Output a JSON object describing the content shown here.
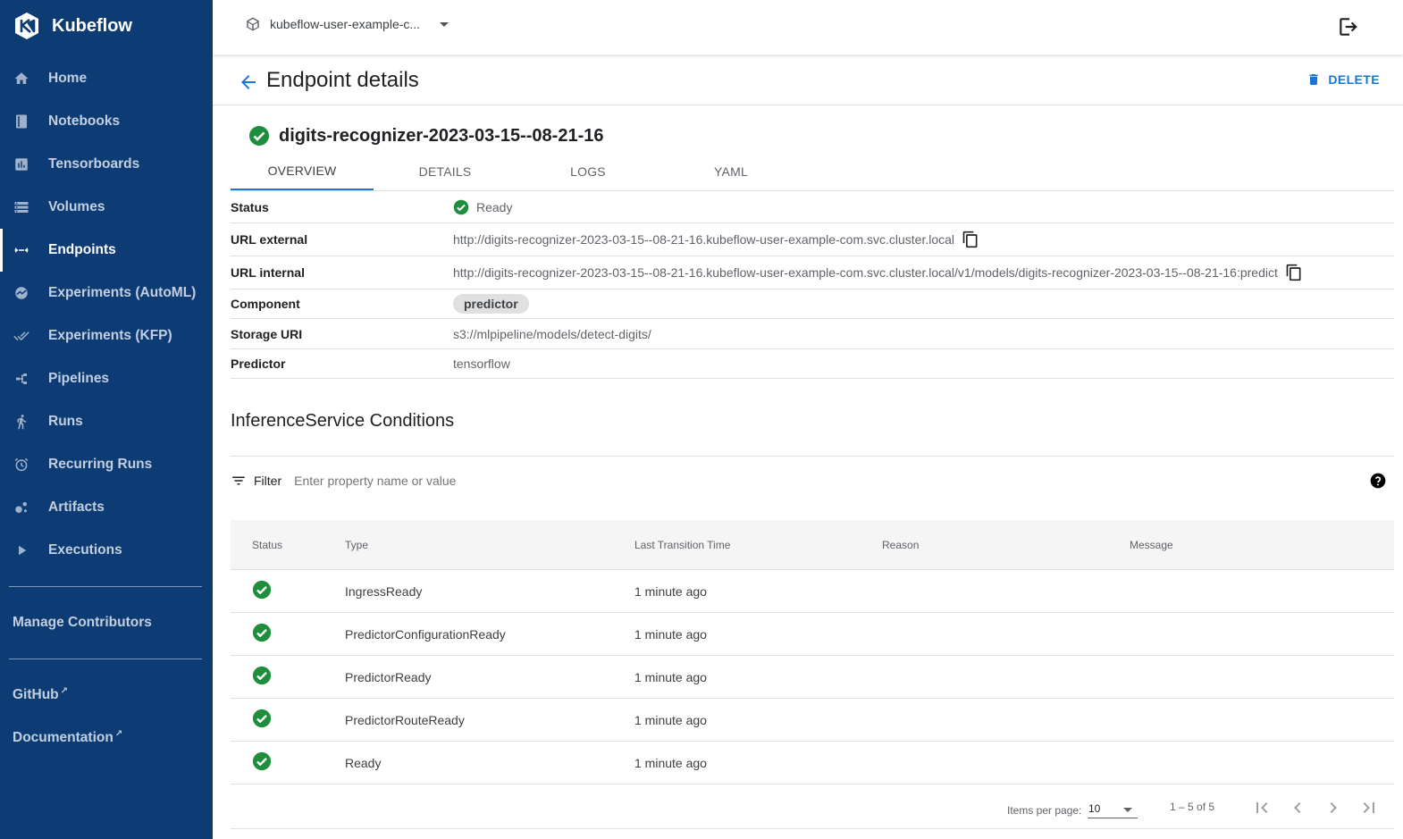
{
  "brand": {
    "name": "Kubeflow"
  },
  "sidebar": {
    "items": [
      {
        "label": "Home",
        "icon": "home-icon"
      },
      {
        "label": "Notebooks",
        "icon": "notebook-icon"
      },
      {
        "label": "Tensorboards",
        "icon": "chart-icon"
      },
      {
        "label": "Volumes",
        "icon": "storage-icon"
      },
      {
        "label": "Endpoints",
        "icon": "code-arrows-icon"
      },
      {
        "label": "Experiments (AutoML)",
        "icon": "automl-icon"
      },
      {
        "label": "Experiments (KFP)",
        "icon": "done-all-icon"
      },
      {
        "label": "Pipelines",
        "icon": "pipeline-icon"
      },
      {
        "label": "Runs",
        "icon": "run-icon"
      },
      {
        "label": "Recurring Runs",
        "icon": "alarm-icon"
      },
      {
        "label": "Artifacts",
        "icon": "bubble-icon"
      },
      {
        "label": "Executions",
        "icon": "play-icon"
      }
    ],
    "manage": "Manage Contributors",
    "github": "GitHub",
    "docs": "Documentation"
  },
  "topbar": {
    "namespace": "kubeflow-user-example-c..."
  },
  "header": {
    "title": "Endpoint details",
    "delete": "DELETE"
  },
  "resource": {
    "name": "digits-recognizer-2023-03-15--08-21-16"
  },
  "tabs": [
    "OVERVIEW",
    "DETAILS",
    "LOGS",
    "YAML"
  ],
  "details": {
    "status_key": "Status",
    "status_val": "Ready",
    "url_ext_key": "URL external",
    "url_ext_val": "http://digits-recognizer-2023-03-15--08-21-16.kubeflow-user-example-com.svc.cluster.local",
    "url_int_key": "URL internal",
    "url_int_val": "http://digits-recognizer-2023-03-15--08-21-16.kubeflow-user-example-com.svc.cluster.local/v1/models/digits-recognizer-2023-03-15--08-21-16:predict",
    "component_key": "Component",
    "component_val": "predictor",
    "storage_key": "Storage URI",
    "storage_val": "s3://mlpipeline/models/detect-digits/",
    "predictor_key": "Predictor",
    "predictor_val": "tensorflow"
  },
  "conditions": {
    "title": "InferenceService Conditions",
    "filter_label": "Filter",
    "filter_placeholder": "Enter property name or value",
    "columns": [
      "Status",
      "Type",
      "Last Transition Time",
      "Reason",
      "Message"
    ],
    "rows": [
      {
        "type": "IngressReady",
        "time": "1 minute ago",
        "reason": "",
        "message": ""
      },
      {
        "type": "PredictorConfigurationReady",
        "time": "1 minute ago",
        "reason": "",
        "message": ""
      },
      {
        "type": "PredictorReady",
        "time": "1 minute ago",
        "reason": "",
        "message": ""
      },
      {
        "type": "PredictorRouteReady",
        "time": "1 minute ago",
        "reason": "",
        "message": ""
      },
      {
        "type": "Ready",
        "time": "1 minute ago",
        "reason": "",
        "message": ""
      }
    ]
  },
  "pager": {
    "items_per_page_label": "Items per page:",
    "items_per_page": "10",
    "range": "1 – 5 of 5"
  },
  "colors": {
    "sidebar": "#0d3b73",
    "accent": "#1976d2",
    "success": "#1e8e3e"
  }
}
